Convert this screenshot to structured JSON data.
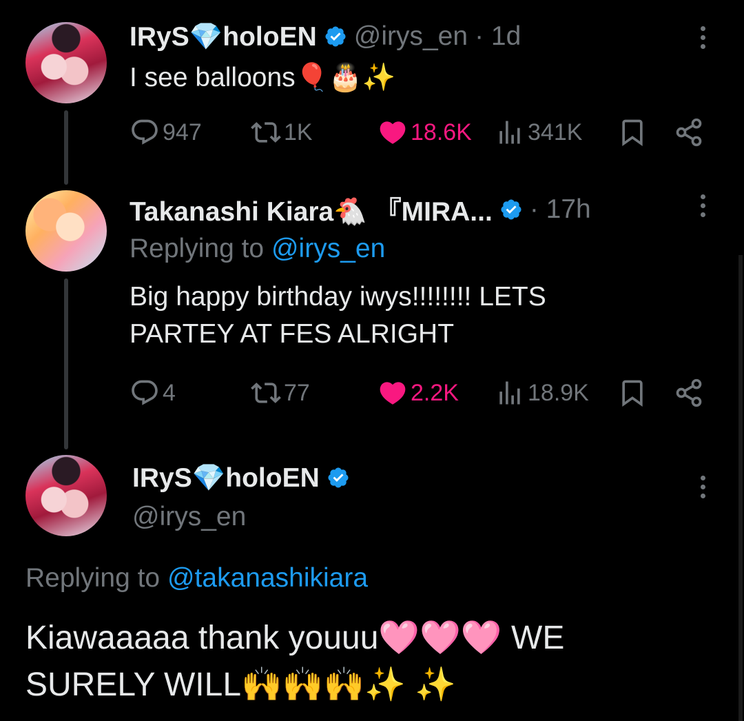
{
  "tweets": [
    {
      "display_name": "IRyS💎holoEN",
      "handle": "@irys_en",
      "time": "· 1d",
      "text": "I see balloons🎈🎂✨",
      "actions": {
        "replies": "947",
        "retweets": "1K",
        "likes": "18.6K",
        "views": "341K"
      }
    },
    {
      "display_name": "Takanashi Kiara🐔 『MIRA...",
      "time": "· 17h",
      "replying_label": "Replying to",
      "replying_handle": "@irys_en",
      "text_line1": "Big happy birthday iwys!!!!!!!! LETS",
      "text_line2": "PARTEY AT FES ALRIGHT",
      "actions": {
        "replies": "4",
        "retweets": "77",
        "likes": "2.2K",
        "views": "18.9K"
      }
    },
    {
      "display_name": "IRyS💎holoEN",
      "handle": "@irys_en",
      "replying_label": "Replying to",
      "replying_handle": "@takanashikiara",
      "text_line1": "Kiawaaaaa thank youuu🩷🩷🩷 WE",
      "text_line2": "SURELY WILL🙌🙌🙌✨ ✨"
    }
  ],
  "icons": {
    "reply": "reply-icon",
    "retweet": "retweet-icon",
    "like": "heart-icon",
    "views": "views-icon",
    "bookmark": "bookmark-icon",
    "share": "share-icon",
    "verified": "verified-badge-icon",
    "more": "more-dots-icon"
  },
  "colors": {
    "background": "#000000",
    "text": "#e7e9ea",
    "muted": "#71767b",
    "link": "#1d9bf0",
    "like": "#f91880",
    "verified": "#1d9bf0"
  }
}
